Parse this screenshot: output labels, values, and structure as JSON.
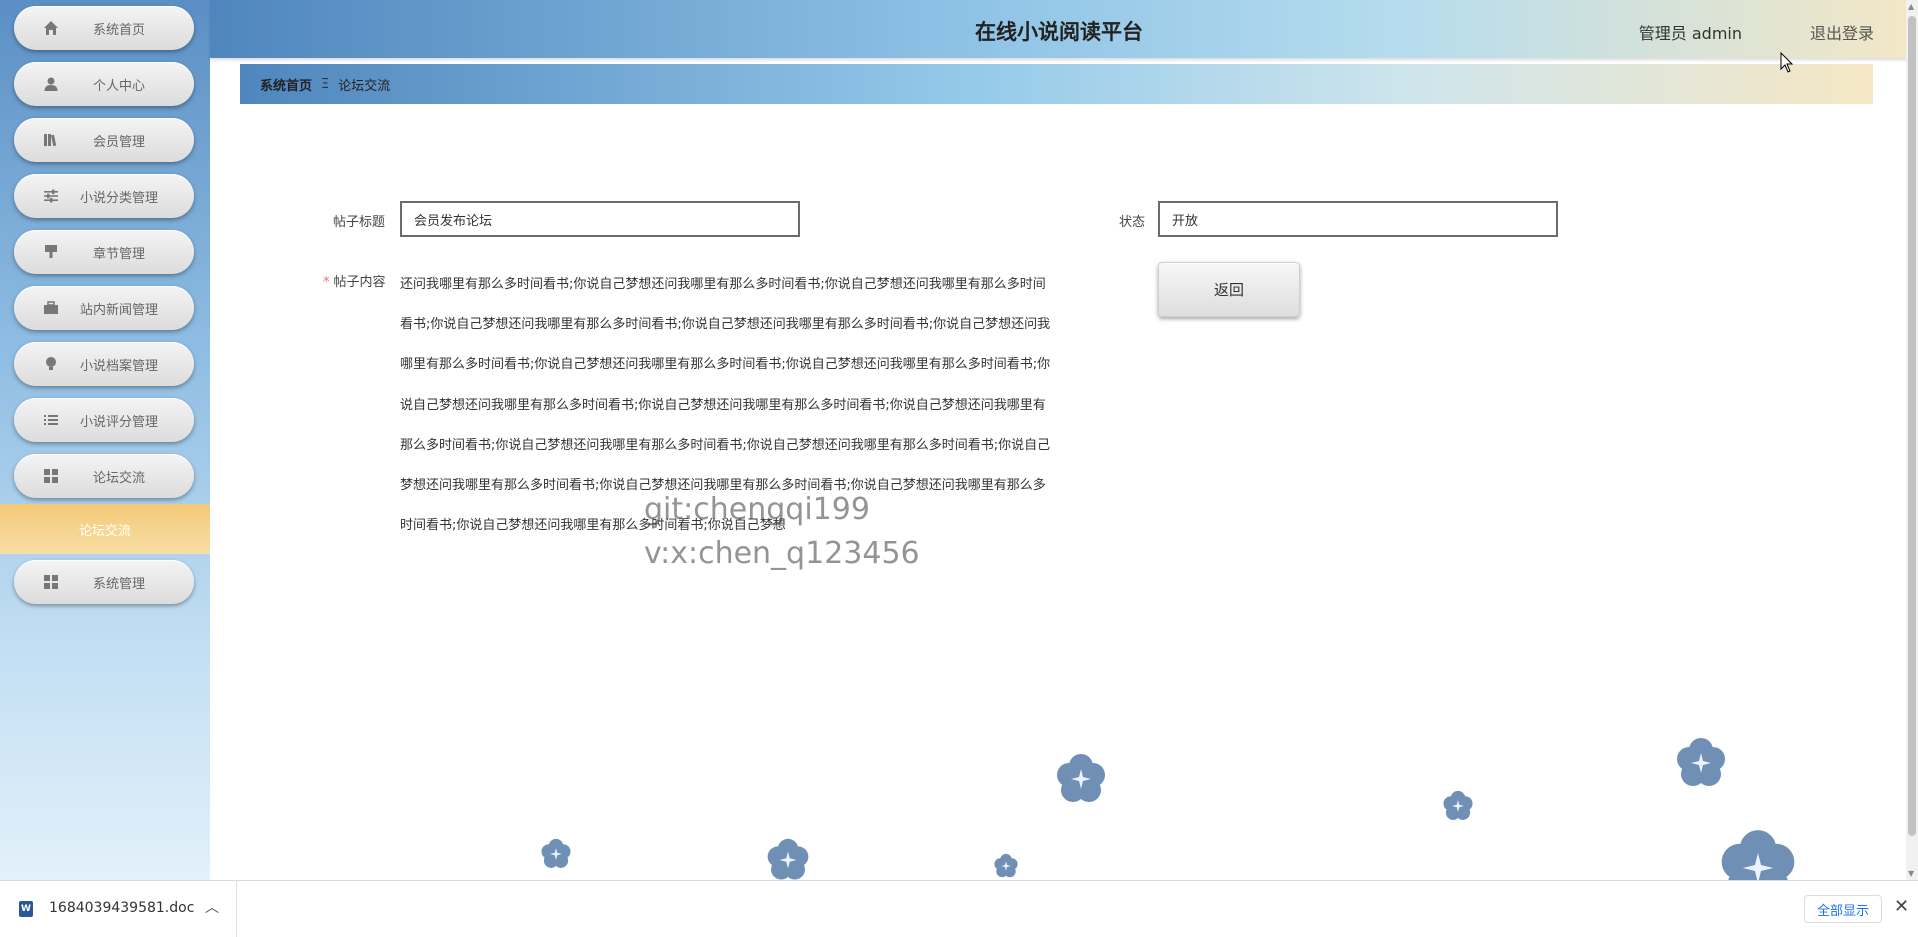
{
  "header": {
    "title": "在线小说阅读平台",
    "user_label": "管理员 admin",
    "logout_label": "退出登录"
  },
  "sidebar": {
    "items": [
      {
        "label": "系统首页",
        "icon": "home-icon"
      },
      {
        "label": "个人中心",
        "icon": "user-icon"
      },
      {
        "label": "会员管理",
        "icon": "library-icon"
      },
      {
        "label": "小说分类管理",
        "icon": "sliders-icon"
      },
      {
        "label": "章节管理",
        "icon": "stamp-icon"
      },
      {
        "label": "站内新闻管理",
        "icon": "briefcase-icon"
      },
      {
        "label": "小说档案管理",
        "icon": "bulb-icon"
      },
      {
        "label": "小说评分管理",
        "icon": "list-icon"
      },
      {
        "label": "论坛交流",
        "icon": "grid-icon"
      },
      {
        "label": "系统管理",
        "icon": "grid-icon"
      }
    ],
    "active_sub": "论坛交流"
  },
  "breadcrumb": {
    "home": "系统首页",
    "separator": "Ξ",
    "current": "论坛交流"
  },
  "form": {
    "title_label": "帖子标题",
    "title_value": "会员发布论坛",
    "status_label": "状态",
    "status_value": "开放",
    "required_mark": "*",
    "content_label": "帖子内容",
    "content_text": "还问我哪里有那么多时间看书;你说自己梦想还问我哪里有那么多时间看书;你说自己梦想还问我哪里有那么多时间看书;你说自己梦想还问我哪里有那么多时间看书;你说自己梦想还问我哪里有那么多时间看书;你说自己梦想还问我哪里有那么多时间看书;你说自己梦想还问我哪里有那么多时间看书;你说自己梦想还问我哪里有那么多时间看书;你说自己梦想还问我哪里有那么多时间看书;你说自己梦想还问我哪里有那么多时间看书;你说自己梦想还问我哪里有那么多时间看书;你说自己梦想还问我哪里有那么多时间看书;你说自己梦想还问我哪里有那么多时间看书;你说自己梦想还问我哪里有那么多时间看书;你说自己梦想还问我哪里有那么多时间看书;你说自己梦想还问我哪里有那么多时间看书;你说自己梦想还问我哪里有那么多时间看书;你说自己梦想",
    "back_button": "返回"
  },
  "watermark": {
    "line1": "git:chengqi199",
    "line2": "v:x:chen_q123456"
  },
  "download_bar": {
    "file_name": "1684039439581.doc",
    "show_all": "全部显示",
    "file_icon": "word-doc-icon",
    "close_icon": "close-icon"
  },
  "colors": {
    "active_menu": "#f2c977",
    "flower": "#6f8fb5"
  }
}
